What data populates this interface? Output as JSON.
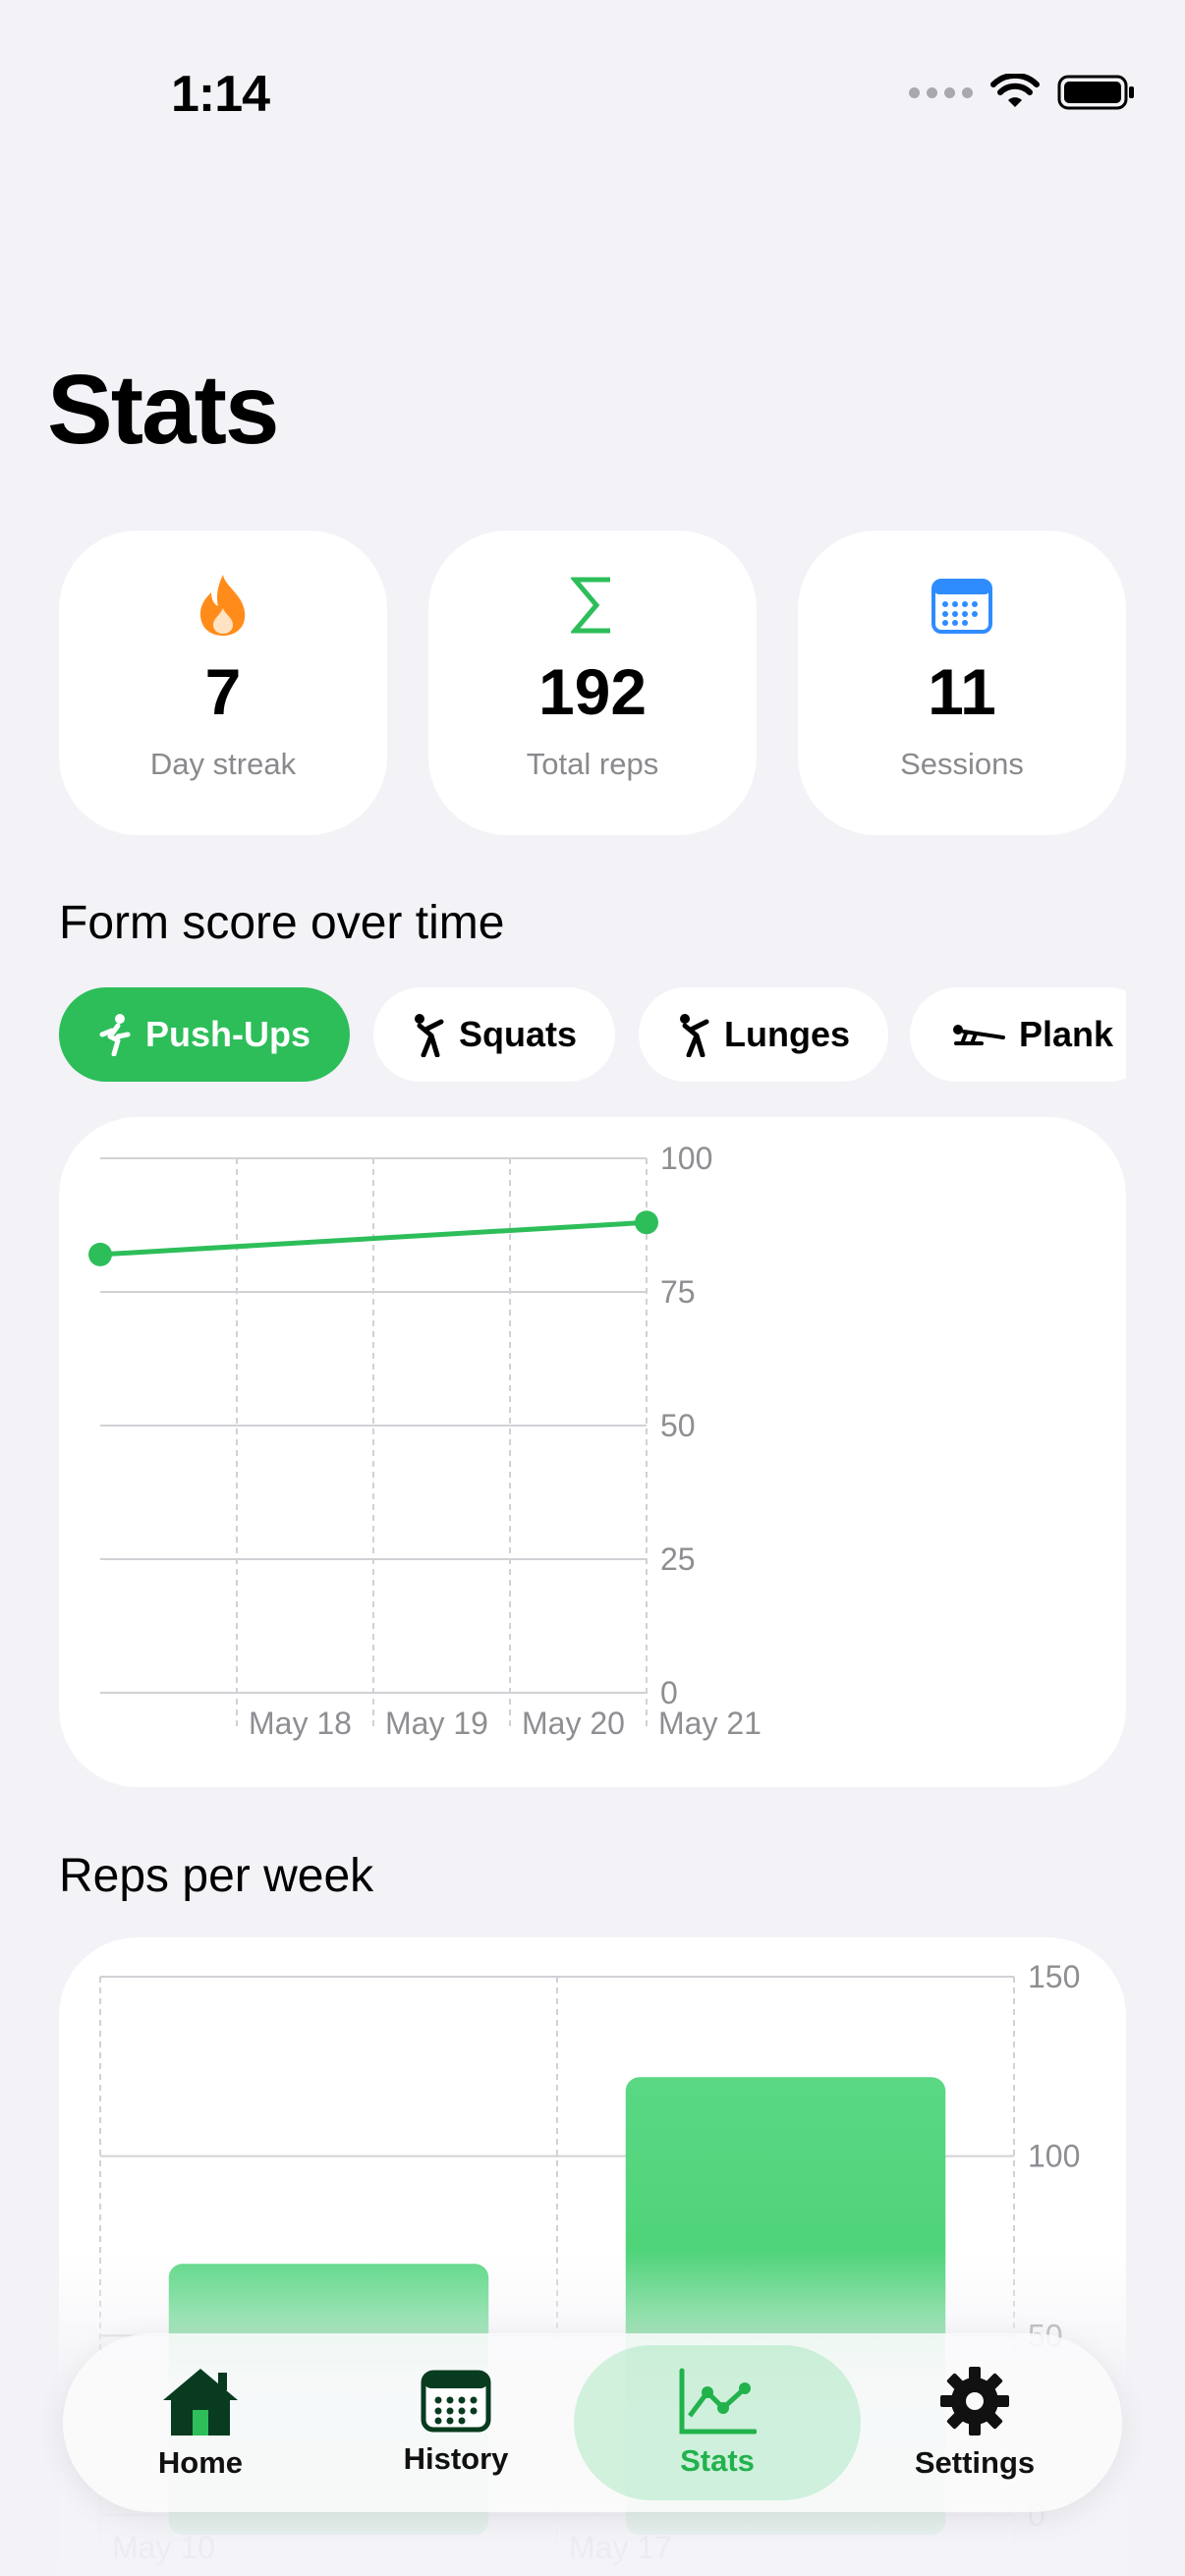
{
  "status_bar": {
    "time": "1:14"
  },
  "page_title": "Stats",
  "stats": [
    {
      "icon": "flame-icon",
      "value": "7",
      "label": "Day streak",
      "color": "#ff8c1a"
    },
    {
      "icon": "sigma-icon",
      "value": "192",
      "label": "Total reps",
      "color": "#2dbe5a"
    },
    {
      "icon": "calendar-icon",
      "value": "11",
      "label": "Sessions",
      "color": "#2f8cff"
    }
  ],
  "form_section": {
    "title": "Form score over time",
    "chips": [
      {
        "label": "Push-Ups",
        "icon": "runner-icon",
        "active": true
      },
      {
        "label": "Squats",
        "icon": "stretch-icon",
        "active": false
      },
      {
        "label": "Lunges",
        "icon": "stretch-icon",
        "active": false
      },
      {
        "label": "Plank",
        "icon": "plank-icon",
        "active": false
      }
    ]
  },
  "reps_section": {
    "title": "Reps per week"
  },
  "tabs": [
    {
      "label": "Home",
      "icon": "house-icon",
      "active": false
    },
    {
      "label": "History",
      "icon": "calendar-icon",
      "active": false
    },
    {
      "label": "Stats",
      "icon": "chart-icon",
      "active": true
    },
    {
      "label": "Settings",
      "icon": "gear-icon",
      "active": false
    }
  ],
  "colors": {
    "accent": "#2dbe5a",
    "background": "#f2f2f7"
  },
  "chart_data": [
    {
      "type": "line",
      "title": "Form score over time",
      "x": [
        "May 18",
        "May 21"
      ],
      "x_ticks": [
        "May 18",
        "May 19",
        "May 20",
        "May 21"
      ],
      "x_range": [
        "May 17",
        "May 21"
      ],
      "series": [
        {
          "points": [
            {
              "x": "May 17",
              "y": 82
            },
            {
              "x": "May 21",
              "y": 88
            }
          ]
        }
      ],
      "y_ticks": [
        0,
        25,
        50,
        75,
        100
      ],
      "ylim": [
        0,
        100
      ],
      "grid": true,
      "color": "#2dbe5a"
    },
    {
      "type": "bar",
      "title": "Reps per week",
      "categories": [
        "May 10",
        "May 17"
      ],
      "values": [
        70,
        122
      ],
      "y_ticks": [
        0,
        50,
        100,
        150
      ],
      "ylim": [
        0,
        150
      ],
      "grid": true,
      "color": "#3dcc68"
    }
  ]
}
